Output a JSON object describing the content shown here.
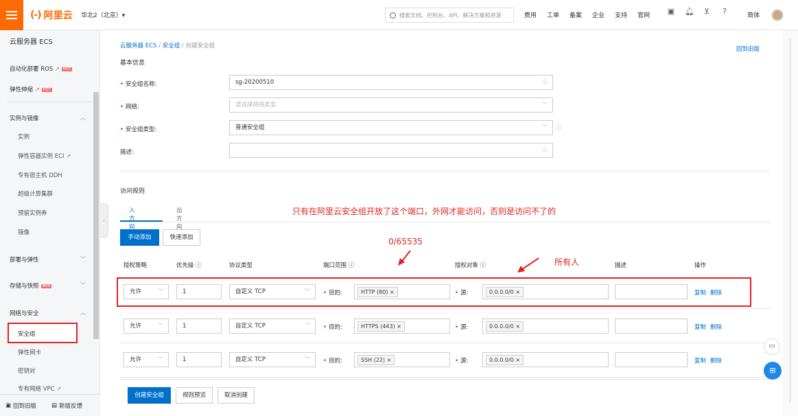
{
  "topbar": {
    "logo_mark": "(-)",
    "logo_text": "阿里云",
    "region": "华北2（北京）▾",
    "search_placeholder": "搜索文档、控制台、API、解决方案和资源",
    "nav": [
      "费用",
      "工单",
      "备案",
      "企业",
      "支持",
      "官网"
    ],
    "lang": "简体"
  },
  "sidebar": {
    "title": "云服务器 ECS",
    "items": [
      {
        "label": "自动化部署 ROS",
        "badge": "HOT"
      },
      {
        "label": "弹性伸缩",
        "badge": "HOT"
      }
    ],
    "groups": [
      {
        "label": "实例与镜像",
        "chevron": "︿",
        "children": [
          "实例",
          "弹性容器实例 ECI",
          "专有宿主机 DDH",
          "超级计算集群",
          "预留实例券",
          "镜像"
        ]
      },
      {
        "label": "部署与弹性",
        "chevron": "﹀"
      },
      {
        "label": "存储与快照",
        "badge": "NEW",
        "chevron": "﹀"
      },
      {
        "label": "网络与安全",
        "chevron": "︿",
        "children": [
          "安全组",
          "弹性网卡",
          "密钥对",
          "专有网络 VPC"
        ]
      }
    ],
    "active": "安全组",
    "bottom": {
      "old_version": "回到旧版",
      "feedback": "新版反馈"
    }
  },
  "breadcrumb": {
    "item1": "云服务器 ECS",
    "item2": "安全组",
    "current": "创建安全组",
    "sep": "/"
  },
  "back_old": "回到旧版",
  "basic": {
    "title": "基本信息",
    "name_label": "安全组名称:",
    "name_value": "sg-20200510",
    "network_label": "网络:",
    "network_placeholder": "请选择网络类型",
    "type_label": "安全组类型:",
    "type_value": "普通安全组",
    "desc_label": "描述:"
  },
  "rules": {
    "title": "访问规则",
    "tab_in": "入方向",
    "tab_out": "出方向",
    "btn_manual": "手动添加",
    "btn_quick": "快速添加",
    "headers": [
      "授权策略",
      "优先级 ⓘ",
      "协议类型",
      "端口范围 ⓘ",
      "授权对象 ⓘ",
      "描述",
      "操作"
    ],
    "dest_label": "目的:",
    "src_label": "源:",
    "copy": "复制",
    "delete": "删除",
    "rows": [
      {
        "policy": "允许",
        "priority": "1",
        "protocol": "自定义 TCP",
        "port": "HTTP (80)",
        "source": "0.0.0.0/0"
      },
      {
        "policy": "允许",
        "priority": "1",
        "protocol": "自定义 TCP",
        "port": "HTTPS (443)",
        "source": "0.0.0.0/0"
      },
      {
        "policy": "允许",
        "priority": "1",
        "protocol": "自定义 TCP",
        "port": "SSH (22)",
        "source": "0.0.0.0/0"
      }
    ]
  },
  "footer": {
    "create": "创建安全组",
    "preview": "规则预览",
    "cancel": "取消创建"
  },
  "annotations": {
    "note": "只有在阿里云安全组开放了这个端口，外网才能访问，否则是访问不了的",
    "port": "0/65535",
    "all": "所有人"
  },
  "colors": {
    "brand": "#ff6a00",
    "link": "#0070cc",
    "annotation": "#e02020"
  }
}
